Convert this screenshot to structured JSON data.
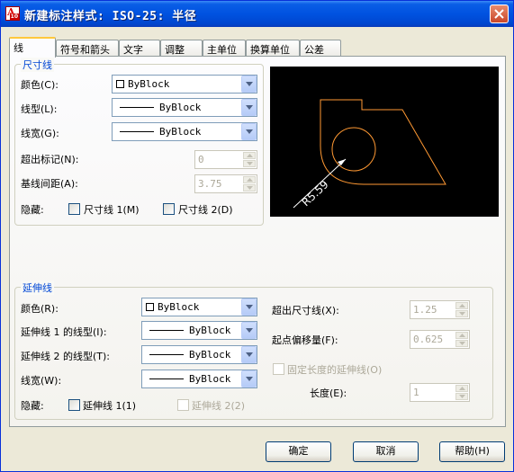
{
  "window": {
    "title": "新建标注样式: ISO-25: 半径",
    "icon_text": "A",
    "icon_badge": "10"
  },
  "tabs": [
    "线",
    "符号和箭头",
    "文字",
    "调整",
    "主单位",
    "换算单位",
    "公差"
  ],
  "dim_lines": {
    "legend": "尺寸线",
    "color_label": "颜色(C):",
    "color_value": "ByBlock",
    "linetype_label": "线型(L):",
    "linetype_value": "ByBlock",
    "lineweight_label": "线宽(G):",
    "lineweight_value": "ByBlock",
    "extend_label": "超出标记(N):",
    "extend_value": "0",
    "baseline_label": "基线间距(A):",
    "baseline_value": "3.75",
    "suppress_label": "隐藏:",
    "suppress1_label": "尺寸线 1(M)",
    "suppress2_label": "尺寸线 2(D)"
  },
  "preview": {
    "dimension_text": "R5.59",
    "line_color": "#ff9933",
    "text_color": "#ffffff"
  },
  "ext_lines": {
    "legend": "延伸线",
    "color_label": "颜色(R):",
    "color_value": "ByBlock",
    "lt1_label": "延伸线 1 的线型(I):",
    "lt1_value": "ByBlock",
    "lt2_label": "延伸线 2 的线型(T):",
    "lt2_value": "ByBlock",
    "lw_label": "线宽(W):",
    "lw_value": "ByBlock",
    "suppress_label": "隐藏:",
    "suppress1_label": "延伸线 1(1)",
    "suppress2_label": "延伸线 2(2)",
    "beyond_label": "超出尺寸线(X):",
    "beyond_value": "1.25",
    "offset_label": "起点偏移量(F):",
    "offset_value": "0.625",
    "fixed_label": "固定长度的延伸线(O)",
    "length_label": "长度(E):",
    "length_value": "1"
  },
  "buttons": {
    "ok": "确定",
    "cancel": "取消",
    "help": "帮助(H)"
  }
}
